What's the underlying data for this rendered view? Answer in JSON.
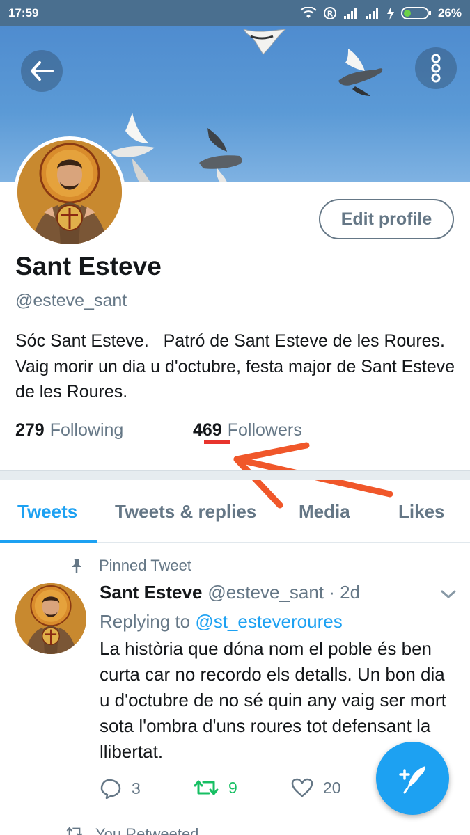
{
  "status_bar": {
    "time": "17:59",
    "battery": "26%",
    "icons": [
      "wifi-icon",
      "registered-icon",
      "signal-icon",
      "signal-icon",
      "charging-icon",
      "battery-icon"
    ]
  },
  "header": {
    "back_icon": "arrow-left-icon",
    "more_icon": "more-vertical-icon"
  },
  "profile": {
    "edit_button": "Edit profile",
    "name": "Sant Esteve",
    "handle": "@esteve_sant",
    "bio": "Sóc Sant Esteve.   Patró de Sant Esteve de les Roures.  Vaig morir un dia u d'octubre, festa major de Sant Esteve de les Roures.",
    "following_count": "279",
    "following_label": "Following",
    "followers_count": "469",
    "followers_label": "Followers"
  },
  "tabs": [
    {
      "label": "Tweets",
      "active": true
    },
    {
      "label": "Tweets & replies",
      "active": false
    },
    {
      "label": "Media",
      "active": false
    },
    {
      "label": "Likes",
      "active": false
    }
  ],
  "pinned_tweet": {
    "pinned_label": "Pinned Tweet",
    "name": "Sant Esteve",
    "handle_time": "@esteve_sant · 2d",
    "replying_prefix": "Replying to",
    "replying_to": "@st_esteveroures",
    "text": "La història que dóna nom el poble és ben curta car no recordo els detalls. Un bon dia u d'octubre de no sé quin any vaig ser mort sota l'ombra d'uns roures tot defensant la llibertat.",
    "reply_count": "3",
    "retweet_count": "9",
    "like_count": "20"
  },
  "next_item": {
    "label": "You Retweeted"
  },
  "colors": {
    "accent": "#1da1f2",
    "retweet": "#17bf63",
    "muted": "#657786",
    "status_bar": "#4a6f8f",
    "annotation": "#f0572a"
  }
}
